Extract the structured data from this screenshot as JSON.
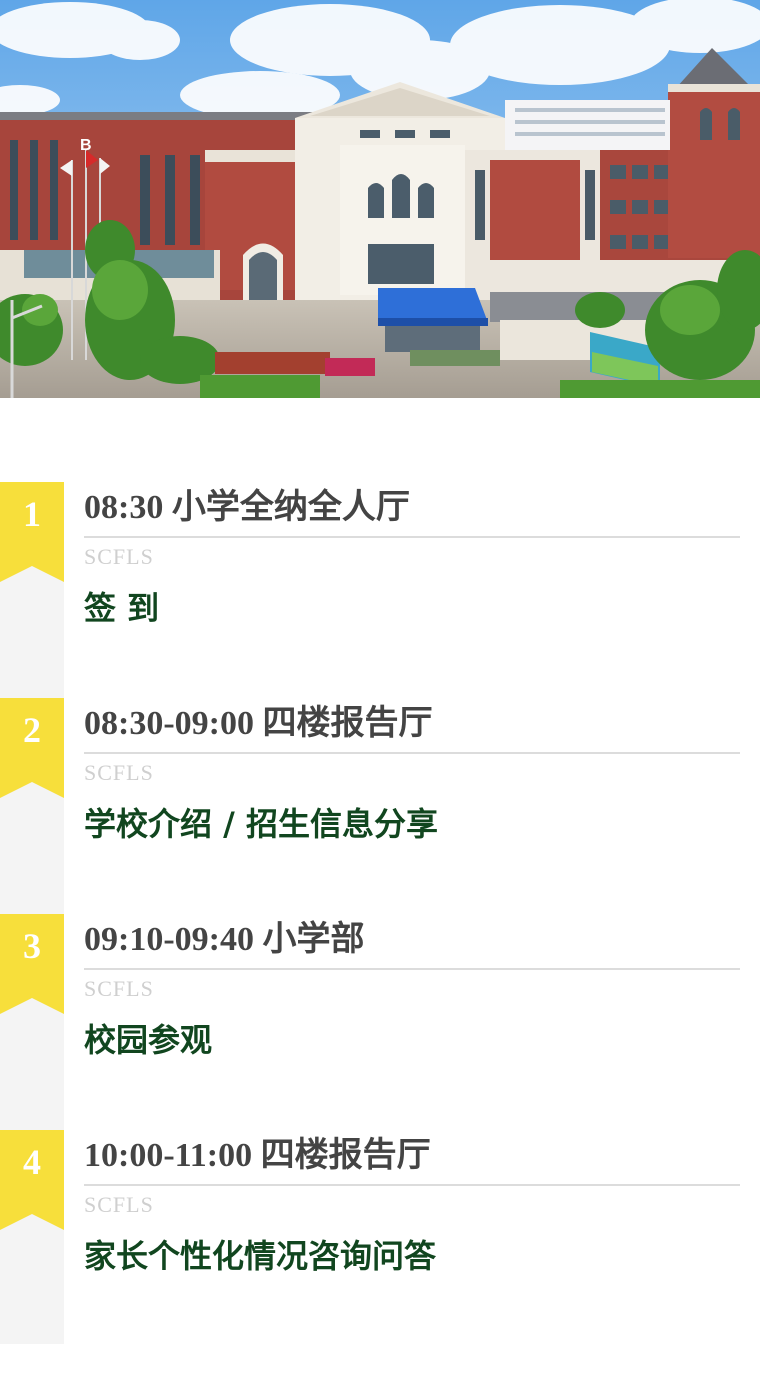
{
  "colors": {
    "badge": "#f7df3b",
    "title": "#444444",
    "accent_green": "#11461f",
    "tag": "#cfcfcf",
    "rail": "#f4f4f4"
  },
  "hero": {
    "image": "school-campus-photo",
    "building_letter": "B"
  },
  "schedule": [
    {
      "num": "1",
      "time": "08:30",
      "location": "小学全纳全人厅",
      "tag": "SCFLS",
      "desc": "签 到"
    },
    {
      "num": "2",
      "time": "08:30-09:00",
      "location": "四楼报告厅",
      "tag": "SCFLS",
      "desc": "学校介绍 / 招生信息分享"
    },
    {
      "num": "3",
      "time": "09:10-09:40",
      "location": "小学部",
      "tag": "SCFLS",
      "desc": "校园参观"
    },
    {
      "num": "4",
      "time": "10:00-11:00",
      "location": "四楼报告厅",
      "tag": "SCFLS",
      "desc": "家长个性化情况咨询问答"
    }
  ]
}
